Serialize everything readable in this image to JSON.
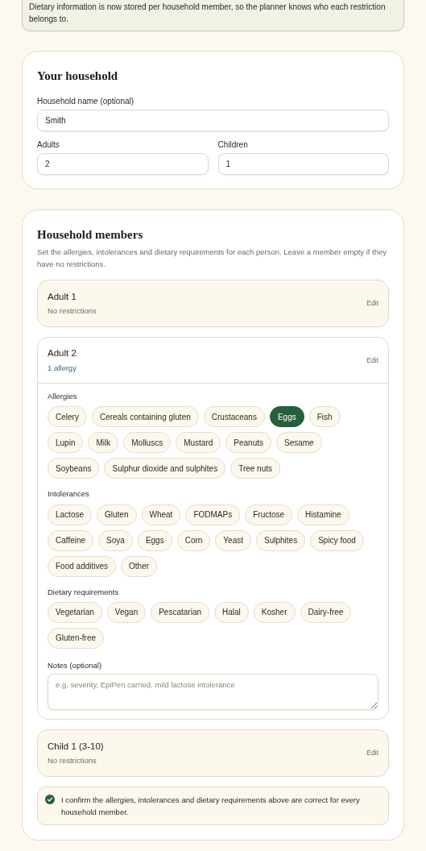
{
  "notice": {
    "text": "Dietary information is now stored per household member, so the planner knows who each restriction belongs to."
  },
  "household": {
    "title": "Your household",
    "name_field": {
      "label": "Household name (optional)",
      "value": "Smith"
    },
    "adults_field": {
      "label": "Adults",
      "value": "2"
    },
    "children_field": {
      "label": "Children",
      "value": "1"
    }
  },
  "members_section": {
    "title": "Household members",
    "description": "Set the allergies, intolerances and dietary requirements for each person. Leave a member empty if they have no restrictions.",
    "members": [
      {
        "name": "Adult 1",
        "summary": "No restrictions",
        "highlight": false,
        "edit_label": "Edit",
        "expanded": false
      },
      {
        "name": "Adult 2",
        "summary": "1 allergy",
        "highlight": true,
        "edit_label": "Edit",
        "expanded": true,
        "groups": [
          {
            "label": "Allergies",
            "options": [
              {
                "label": "Celery",
                "selected": false
              },
              {
                "label": "Cereals containing gluten",
                "selected": false
              },
              {
                "label": "Crustaceans",
                "selected": false
              },
              {
                "label": "Eggs",
                "selected": true
              },
              {
                "label": "Fish",
                "selected": false
              },
              {
                "label": "Lupin",
                "selected": false
              },
              {
                "label": "Milk",
                "selected": false
              },
              {
                "label": "Molluscs",
                "selected": false
              },
              {
                "label": "Mustard",
                "selected": false
              },
              {
                "label": "Peanuts",
                "selected": false
              },
              {
                "label": "Sesame",
                "selected": false
              },
              {
                "label": "Soybeans",
                "selected": false
              },
              {
                "label": "Sulphur dioxide and sulphites",
                "selected": false
              },
              {
                "label": "Tree nuts",
                "selected": false
              }
            ]
          },
          {
            "label": "Intolerances",
            "options": [
              {
                "label": "Lactose",
                "selected": false
              },
              {
                "label": "Gluten",
                "selected": false
              },
              {
                "label": "Wheat",
                "selected": false
              },
              {
                "label": "FODMAPs",
                "selected": false
              },
              {
                "label": "Fructose",
                "selected": false
              },
              {
                "label": "Histamine",
                "selected": false
              },
              {
                "label": "Caffeine",
                "selected": false
              },
              {
                "label": "Soya",
                "selected": false
              },
              {
                "label": "Eggs",
                "selected": false
              },
              {
                "label": "Corn",
                "selected": false
              },
              {
                "label": "Yeast",
                "selected": false
              },
              {
                "label": "Sulphites",
                "selected": false
              },
              {
                "label": "Spicy food",
                "selected": false
              },
              {
                "label": "Food additives",
                "selected": false
              },
              {
                "label": "Other",
                "selected": false
              }
            ]
          },
          {
            "label": "Dietary requirements",
            "options": [
              {
                "label": "Vegetarian",
                "selected": false
              },
              {
                "label": "Vegan",
                "selected": false
              },
              {
                "label": "Pescatarian",
                "selected": false
              },
              {
                "label": "Halal",
                "selected": false
              },
              {
                "label": "Kosher",
                "selected": false
              },
              {
                "label": "Dairy-free",
                "selected": false
              },
              {
                "label": "Gluten-free",
                "selected": false
              }
            ]
          }
        ],
        "notes": {
          "label": "Notes (optional)",
          "placeholder": "e.g. severity, EpiPen carried, mild lactose intolerance"
        }
      },
      {
        "name": "Child 1 (3-10)",
        "summary": "No restrictions",
        "highlight": false,
        "edit_label": "Edit",
        "expanded": false
      }
    ],
    "confirm": {
      "text": "I confirm the allergies, intolerances and dietary requirements above are correct for every household member.",
      "checked": true
    }
  }
}
